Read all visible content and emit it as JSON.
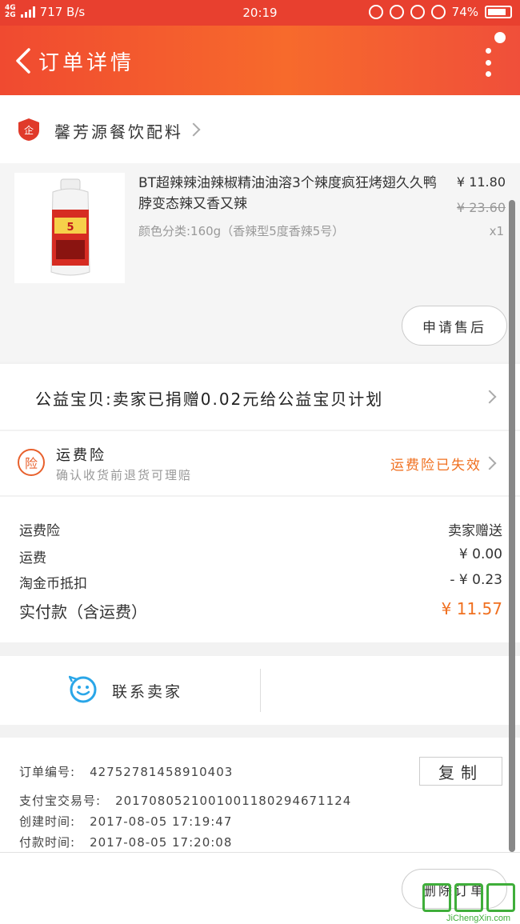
{
  "status_bar": {
    "network_top": "4G",
    "network_bottom": "2G",
    "speed": "717 B/s",
    "time": "20:19",
    "battery": "74%"
  },
  "header": {
    "title": "订单详情"
  },
  "shop": {
    "name": "馨芳源餐饮配料"
  },
  "product": {
    "title": "BT超辣辣油辣椒精油油溶3个辣度疯狂烤翅久久鸭脖变态辣又香又辣",
    "sku": "颜色分类:160g（香辣型5度香辣5号）",
    "price": "¥ 11.80",
    "original_price": "¥ 23.60",
    "quantity": "x1",
    "after_sale_label": "申请售后"
  },
  "charity": {
    "text": "公益宝贝:卖家已捐赠0.02元给公益宝贝计划"
  },
  "insurance": {
    "icon_char": "险",
    "title": "运费险",
    "subtitle": "确认收货前退货可理赔",
    "status": "运费险已失效"
  },
  "fees": [
    {
      "label": "运费险",
      "value": "卖家赠送"
    },
    {
      "label": "运费",
      "value": "¥ 0.00"
    },
    {
      "label": "淘金币抵扣",
      "value": "- ¥ 0.23"
    },
    {
      "label": "实付款（含运费）",
      "value": "¥ 11.57"
    }
  ],
  "contact": {
    "label": "联系卖家"
  },
  "order_info": {
    "order_no_label": "订单编号:",
    "order_no": "42752781458910403",
    "alipay_label": "支付宝交易号:",
    "alipay_no": "2017080521001001180294671124",
    "created_label": "创建时间:",
    "created": "2017-08-05 17:19:47",
    "paid_label": "付款时间:",
    "paid": "2017-08-05 17:20:08",
    "copy_label": "复制"
  },
  "footer": {
    "delete_label": "删除订单"
  },
  "watermark": {
    "text": "JiChengXin.com"
  },
  "colors": {
    "header_red": "#f04a30",
    "accent_orange": "#f07020",
    "contact_blue": "#2aa6e8"
  }
}
